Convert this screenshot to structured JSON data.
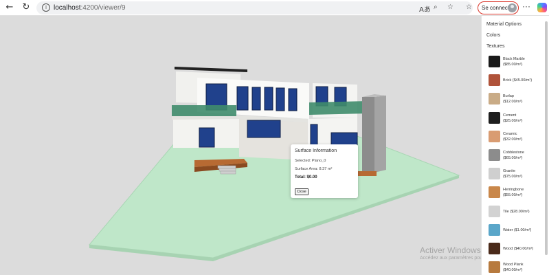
{
  "browser": {
    "url_host": "localhost",
    "url_path": ":4200/viewer/9",
    "signin_label": "Se connecter",
    "back_glyph": "←",
    "reload_glyph": "↻",
    "more_glyph": "···"
  },
  "popup": {
    "title": "Surface Information",
    "selected": "Selected: Plano_0",
    "area": "Surface Area: 8.37 m²",
    "total": "Total: $0.00",
    "close_label": "Close"
  },
  "watermark": {
    "title": "Activer Windows",
    "subtitle": "Accédez aux paramètres pour activer Windows."
  },
  "panel": {
    "title": "Material Options",
    "colors_label": "Colors",
    "textures_label": "Textures",
    "textures": [
      {
        "name": "Black Marble",
        "price": "($85.00/m²)",
        "color": "#1a1a1a"
      },
      {
        "name": "Brick ($45.00/m²)",
        "price": "",
        "color": "#b0533a"
      },
      {
        "name": "Burlap",
        "price": "($12.00/m²)",
        "color": "#c9ab86"
      },
      {
        "name": "Cement",
        "price": "($25.00/m²)",
        "color": "#1e1e1e"
      },
      {
        "name": "Ceramic",
        "price": "($32.00/m²)",
        "color": "#d99c72"
      },
      {
        "name": "Cobblestone",
        "price": "($65.00/m²)",
        "color": "#8c8c8c"
      },
      {
        "name": "Granite",
        "price": "($75.00/m²)",
        "color": "#cfcfcf"
      },
      {
        "name": "Herringbone",
        "price": "($55.00/m²)",
        "color": "#c9874a"
      },
      {
        "name": "Tile ($28.00/m²)",
        "price": "",
        "color": "#d2d2d2"
      },
      {
        "name": "Water ($1.00/m²)",
        "price": "",
        "color": "#5aa6c9"
      },
      {
        "name": "Wood ($40.00/m²)",
        "price": "",
        "color": "#4a2a1a"
      },
      {
        "name": "Wood Plank",
        "price": "($40.00/m²)",
        "color": "#b77a3e"
      }
    ]
  }
}
